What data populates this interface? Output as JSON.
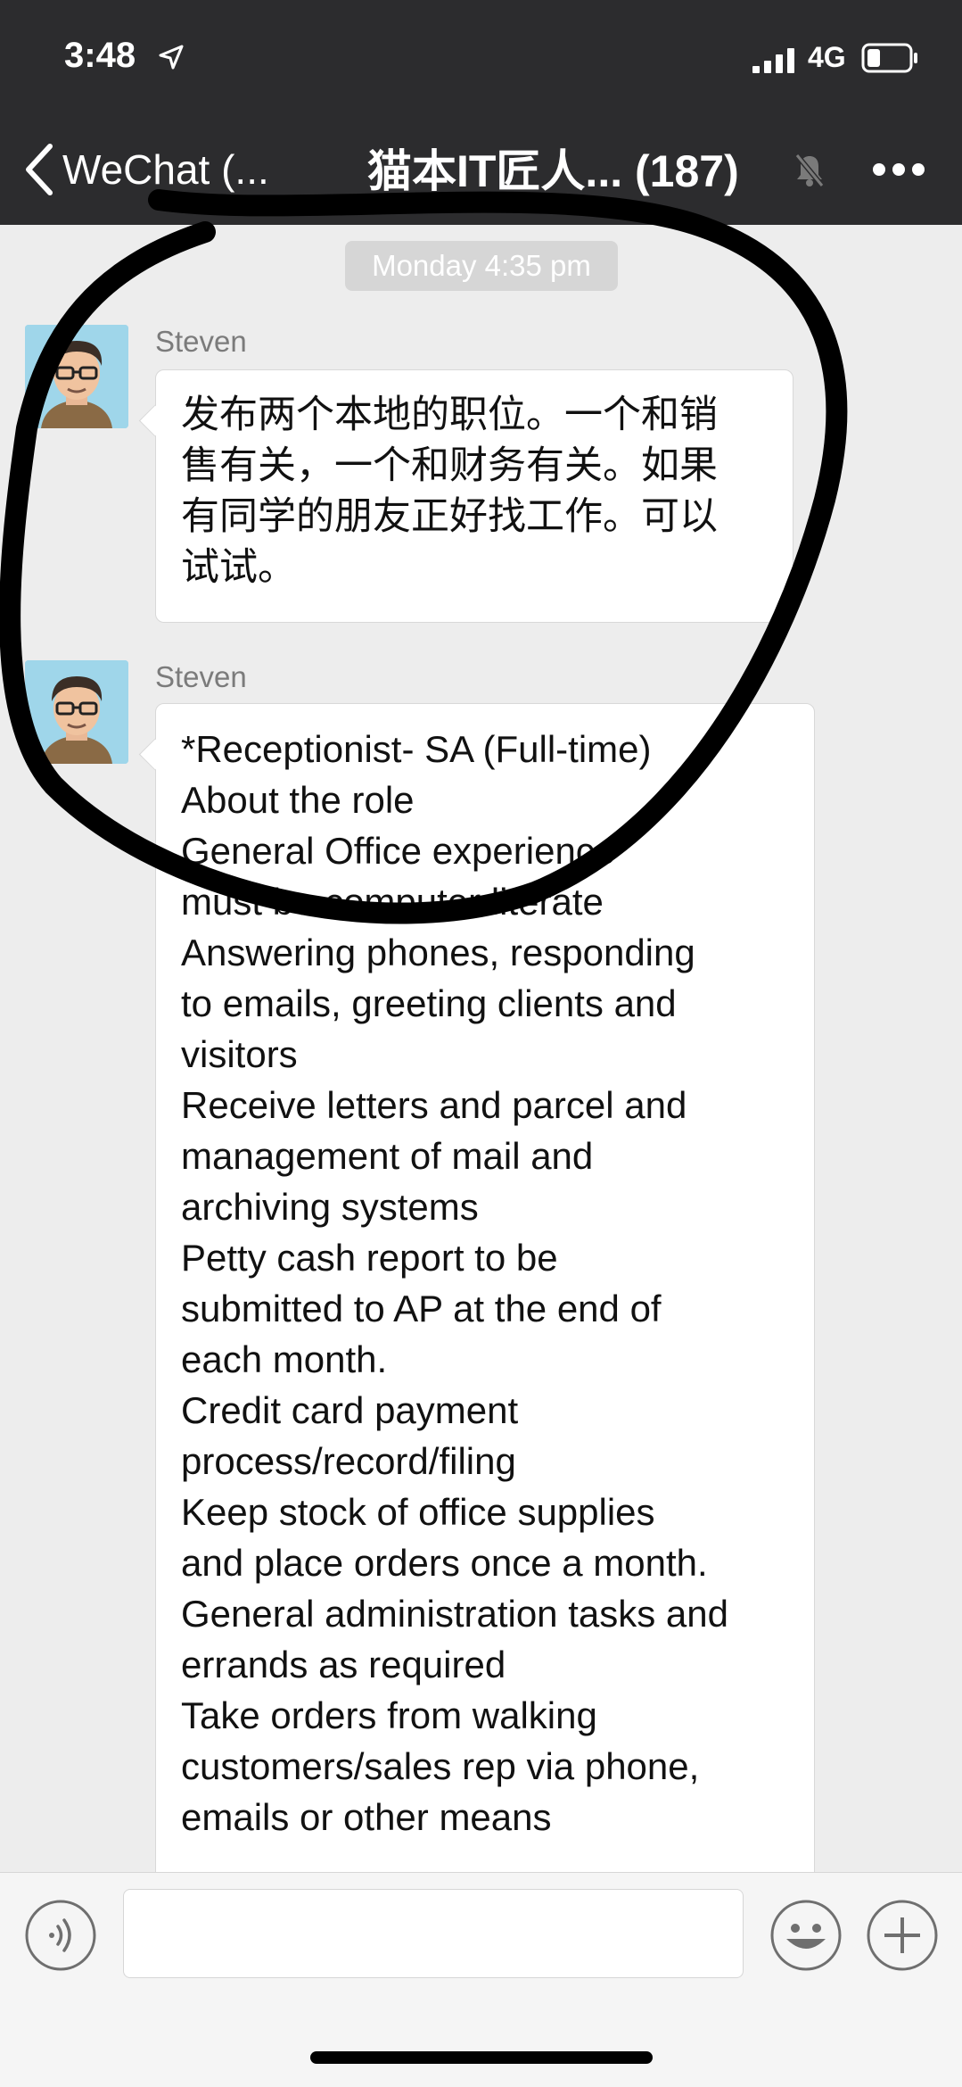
{
  "status_bar": {
    "time": "3:48",
    "network": "4G"
  },
  "nav": {
    "back_label": "WeChat (...",
    "title": "猫本IT匠人... (187)"
  },
  "chat": {
    "timestamp": "Monday 4:35 pm",
    "messages": [
      {
        "sender": "Steven",
        "text": "发布两个本地的职位。一个和销\n售有关，一个和财务有关。如果\n有同学的朋友正好找工作。可以\n试试。"
      },
      {
        "sender": "Steven",
        "text": "*Receptionist- SA (Full-time)\nAbout the role\nGeneral Office experience\nmust be computer literate\nAnswering phones, responding\nto emails, greeting clients and\nvisitors\nReceive letters and parcel and\nmanagement of mail and\narchiving systems\nPetty cash report to be\nsubmitted to AP at the end of\neach month.\nCredit card payment\nprocess/record/filing\nKeep stock of office supplies\nand place orders once a month.\nGeneral administration tasks and\nerrands as required\nTake orders from walking\ncustomers/sales rep via phone,\nemails or other means"
      }
    ]
  },
  "input": {
    "placeholder": ""
  },
  "icons": {
    "back": "chevron-left-icon",
    "mute": "bell-muted-icon",
    "more": "more-dots-icon",
    "voice": "voice-icon",
    "emoji": "emoji-icon",
    "plus": "plus-icon"
  },
  "colors": {
    "nav_bg": "#2c2c2e",
    "chat_bg": "#ededed",
    "bubble_bg": "#ffffff",
    "annotation": "#000000"
  }
}
